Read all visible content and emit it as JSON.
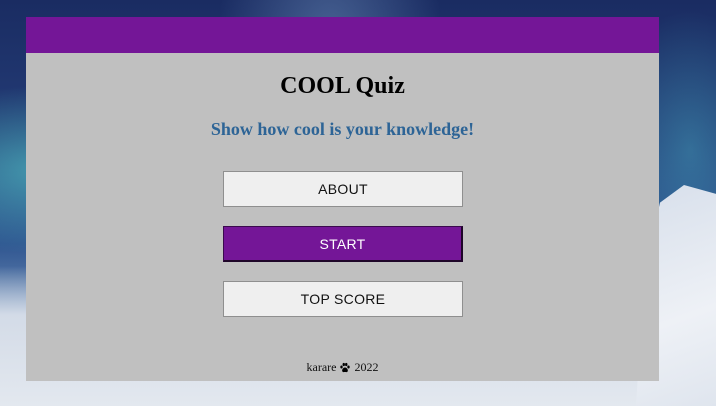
{
  "header": {
    "color": "#741697"
  },
  "quiz": {
    "title": "COOL Quiz",
    "subtitle": "Show how cool is your knowledge!"
  },
  "buttons": {
    "about": "ABOUT",
    "start": "START",
    "top_score": "TOP SCORE"
  },
  "footer": {
    "author": "karare",
    "icon": "paw-icon",
    "year": "2022"
  },
  "colors": {
    "accent": "#741697",
    "card_background": "#c0c0c0",
    "subtitle": "#2d6496"
  }
}
